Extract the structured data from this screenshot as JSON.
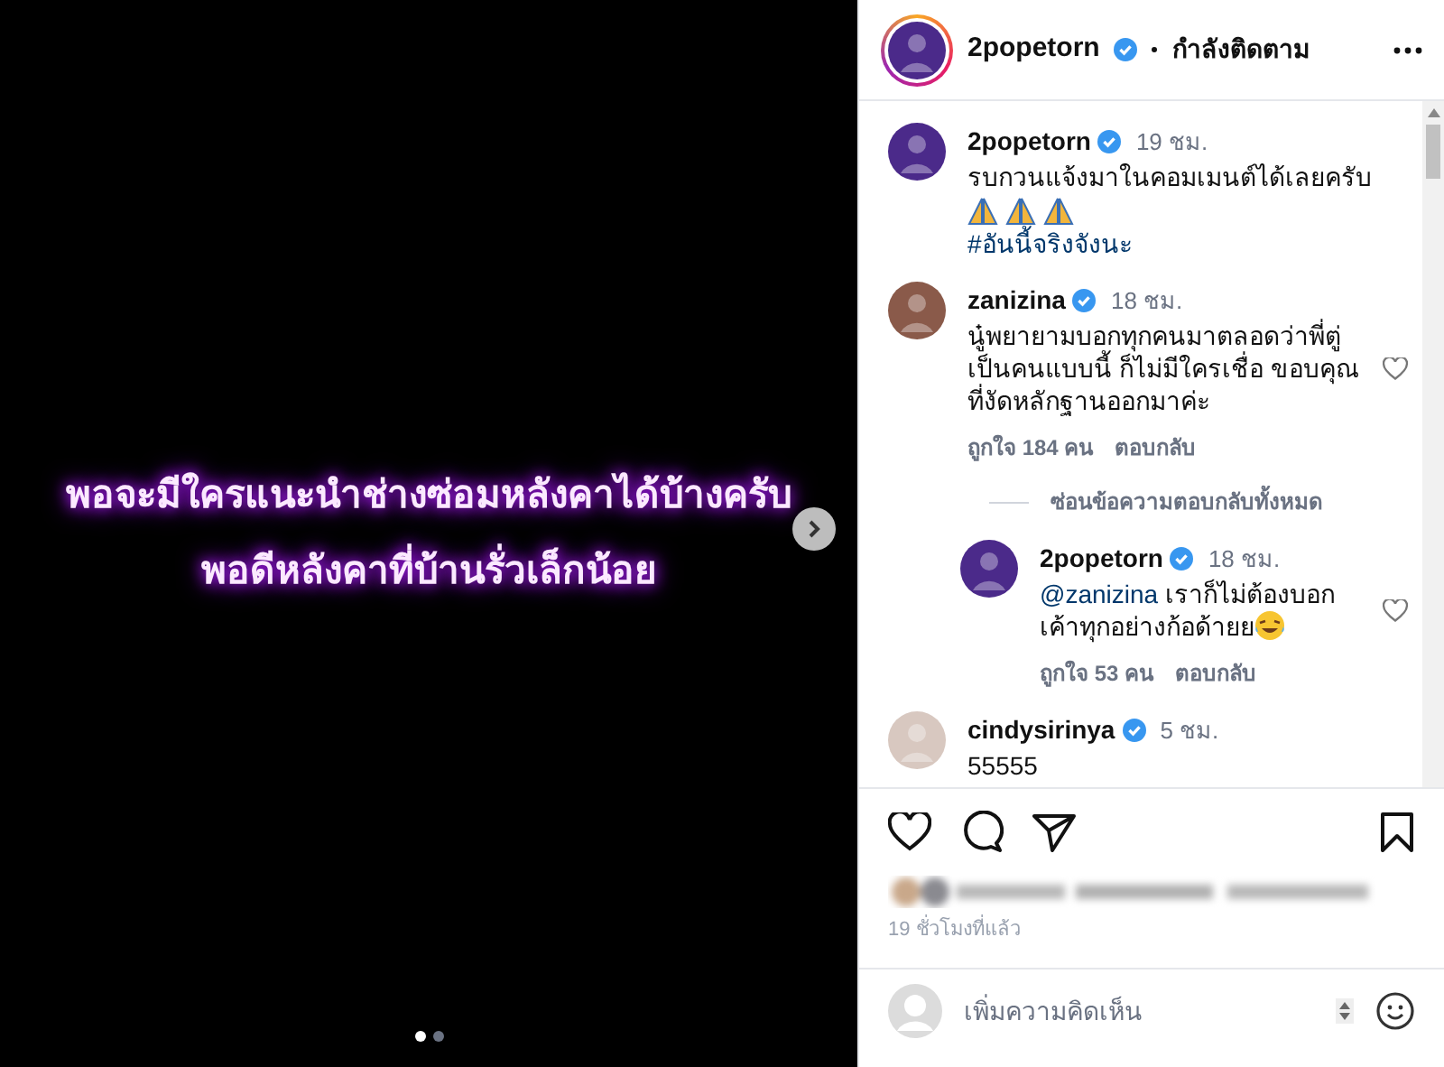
{
  "post_image": {
    "lines": [
      "พอจะมีใครแนะนำช่างซ่อมหลังคาได้บ้างครับ",
      "พอดีหลังคาที่บ้านรั่วเล็กน้อย"
    ],
    "dots": [
      {
        "selected": true
      },
      {
        "selected": false
      }
    ]
  },
  "header": {
    "username": "2popetorn",
    "verified": true,
    "follow_label": "กำลังติดตาม"
  },
  "comments": [
    {
      "username": "2popetorn",
      "verified": true,
      "time": "19 ชม.",
      "text": "รบกวนแจ้งมาในคอมเมนต์ได้เลยครับ",
      "emojis": [
        {
          "kind": "pray"
        },
        {
          "kind": "pray"
        },
        {
          "kind": "pray"
        }
      ],
      "hashtag": "#อันนี้จริงจังนะ",
      "reply": false
    },
    {
      "username": "zanizina",
      "verified": true,
      "time": "18 ชม.",
      "text": "นู๋พยายามบอกทุกคนมาตลอดว่าพี่ตู่เป็นคนแบบนี้ ก็ไม่มีใครเชื่อ ขอบคุณที่งัดหลักฐานออกมาค่ะ",
      "likes": "ถูกใจ 184 คน",
      "reply_label": "ตอบกลับ",
      "hide_replies": "ซ่อนข้อความตอบกลับทั้งหมด",
      "reply": false
    },
    {
      "username": "2popetorn",
      "verified": true,
      "time": "18 ชม.",
      "mention": "@zanizina",
      "text": "เราก็ไม่ต้องบอกเค้าทุกอย่างก้อด้ายย",
      "laugh": true,
      "likes": "ถูกใจ 53 คน",
      "reply_label": "ตอบกลับ",
      "reply": true
    },
    {
      "username": "cindysirinya",
      "verified": true,
      "time": "5 ชม.",
      "text": "55555",
      "reply": false
    }
  ],
  "time_ago": "19 ชั่วโมงที่แล้ว",
  "comment_field": {
    "placeholder": "เพิ่มความคิดเห็น"
  }
}
